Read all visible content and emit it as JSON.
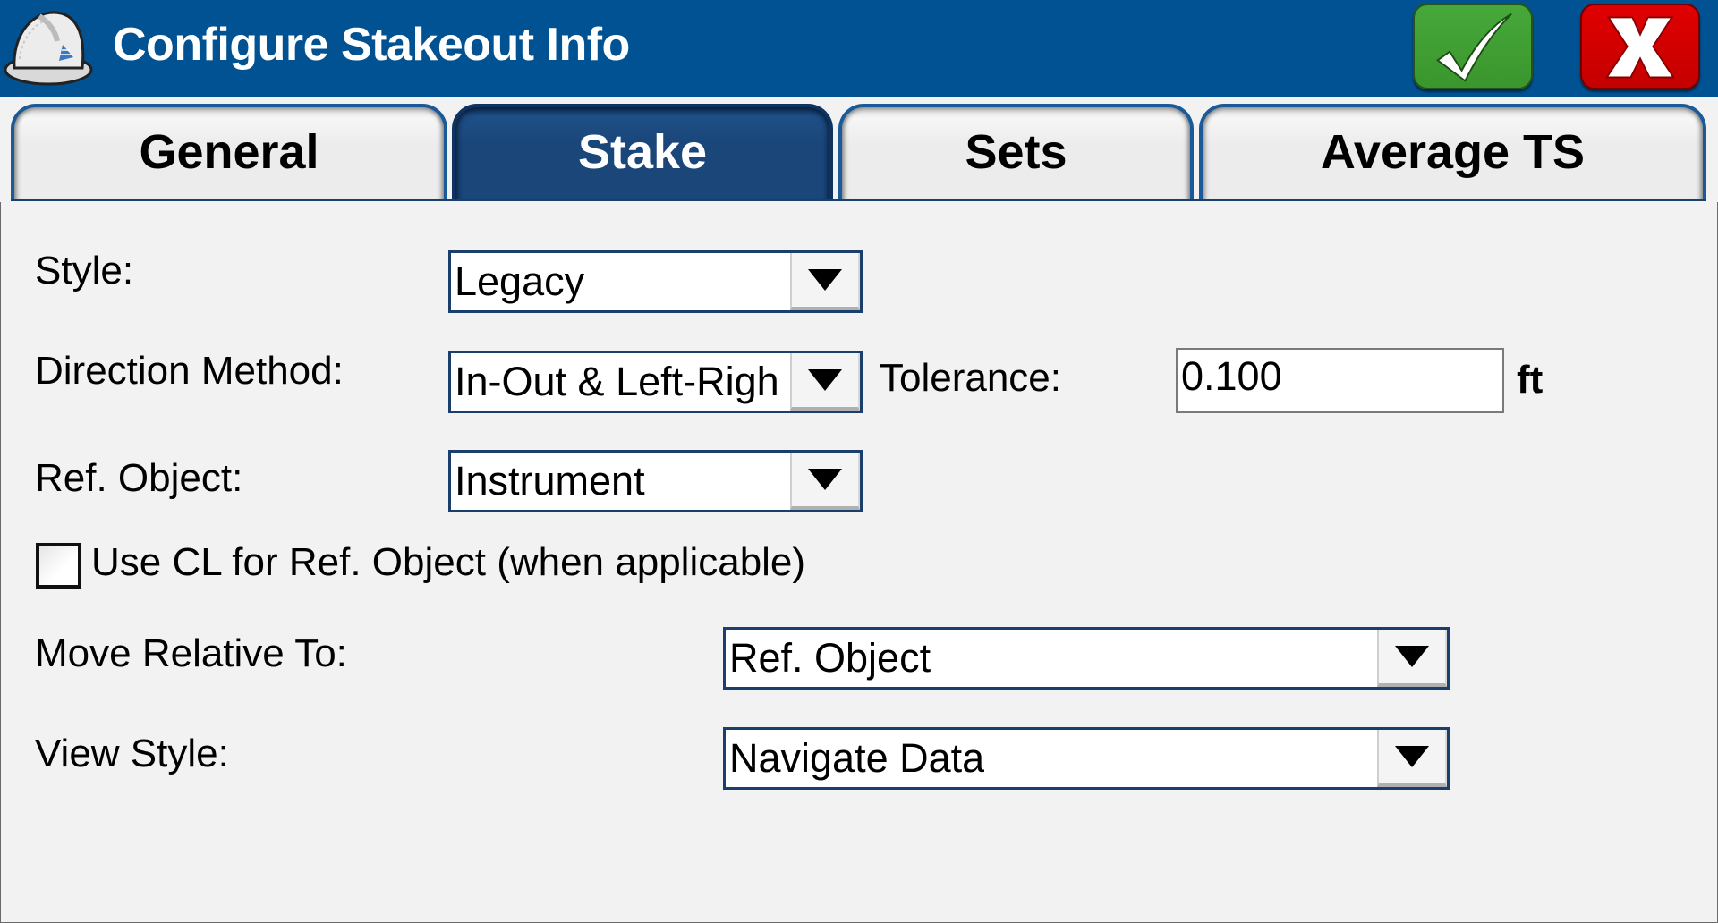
{
  "header": {
    "title": "Configure Stakeout Info",
    "logo_icon": "hard-hat-icon",
    "ok_button": {
      "icon": "checkmark-icon",
      "color": "#3f9c31"
    },
    "cancel_button": {
      "icon": "x-icon",
      "color": "#d80000"
    },
    "bar_color": "#005292"
  },
  "tabs": [
    {
      "label": "General",
      "active": false
    },
    {
      "label": "Stake",
      "active": true
    },
    {
      "label": "Sets",
      "active": false
    },
    {
      "label": "Average TS",
      "active": false
    }
  ],
  "form": {
    "style": {
      "label": "Style:",
      "value": "Legacy"
    },
    "direction_method": {
      "label": "Direction Method:",
      "value": "In-Out & Left-Righ"
    },
    "tolerance": {
      "label": "Tolerance:",
      "value": "0.100",
      "unit": "ft"
    },
    "ref_object": {
      "label": "Ref. Object:",
      "value": "Instrument"
    },
    "use_cl": {
      "label": "Use CL for Ref. Object (when applicable)",
      "checked": false
    },
    "move_relative_to": {
      "label": "Move Relative To:",
      "value": "Ref. Object"
    },
    "view_style": {
      "label": "View Style:",
      "value": "Navigate Data"
    }
  }
}
